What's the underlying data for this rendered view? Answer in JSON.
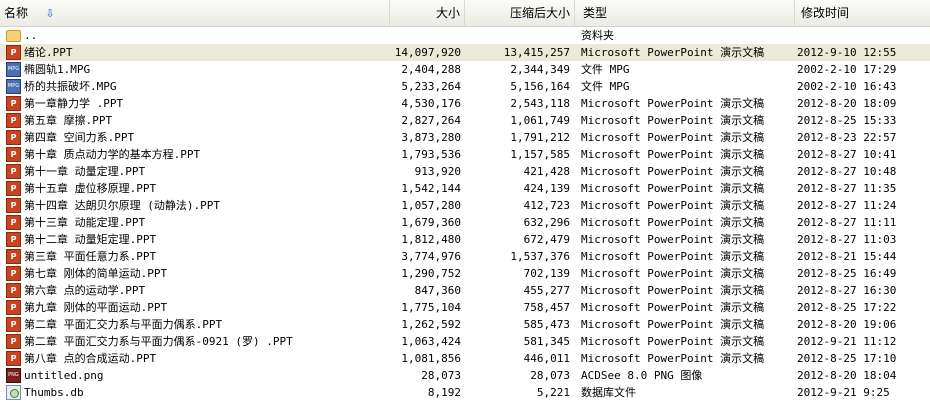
{
  "columns": {
    "name": "名称",
    "size": "大小",
    "compressed": "压缩后大小",
    "type": "类型",
    "modified": "修改时间"
  },
  "files": [
    {
      "name": "..",
      "size": "",
      "compressed": "",
      "type": "资料夹",
      "modified": "",
      "icon": "folder-icon"
    },
    {
      "name": "绪论.PPT",
      "size": "14,097,920",
      "compressed": "13,415,257",
      "type": "Microsoft PowerPoint 演示文稿",
      "modified": "2012-9-10 12:55",
      "icon": "ppt-icon"
    },
    {
      "name": "椭圆轨1.MPG",
      "size": "2,404,288",
      "compressed": "2,344,349",
      "type": "文件 MPG",
      "modified": "2002-2-10 17:29",
      "icon": "mpg-icon"
    },
    {
      "name": "桥的共振破坏.MPG",
      "size": "5,233,264",
      "compressed": "5,156,164",
      "type": "文件 MPG",
      "modified": "2002-2-10 16:43",
      "icon": "mpg-icon"
    },
    {
      "name": "第一章静力学 .PPT",
      "size": "4,530,176",
      "compressed": "2,543,118",
      "type": "Microsoft PowerPoint 演示文稿",
      "modified": "2012-8-20 18:09",
      "icon": "ppt-icon"
    },
    {
      "name": "第五章 摩擦.PPT",
      "size": "2,827,264",
      "compressed": "1,061,749",
      "type": "Microsoft PowerPoint 演示文稿",
      "modified": "2012-8-25 15:33",
      "icon": "ppt-icon"
    },
    {
      "name": "第四章 空间力系.PPT",
      "size": "3,873,280",
      "compressed": "1,791,212",
      "type": "Microsoft PowerPoint 演示文稿",
      "modified": "2012-8-23 22:57",
      "icon": "ppt-icon"
    },
    {
      "name": "第十章 质点动力学的基本方程.PPT",
      "size": "1,793,536",
      "compressed": "1,157,585",
      "type": "Microsoft PowerPoint 演示文稿",
      "modified": "2012-8-27 10:41",
      "icon": "ppt-icon"
    },
    {
      "name": "第十一章 动量定理.PPT",
      "size": "913,920",
      "compressed": "421,428",
      "type": "Microsoft PowerPoint 演示文稿",
      "modified": "2012-8-27 10:48",
      "icon": "ppt-icon"
    },
    {
      "name": "第十五章 虚位移原理.PPT",
      "size": "1,542,144",
      "compressed": "424,139",
      "type": "Microsoft PowerPoint 演示文稿",
      "modified": "2012-8-27 11:35",
      "icon": "ppt-icon"
    },
    {
      "name": "第十四章 达朗贝尔原理 (动静法).PPT",
      "size": "1,057,280",
      "compressed": "412,723",
      "type": "Microsoft PowerPoint 演示文稿",
      "modified": "2012-8-27 11:24",
      "icon": "ppt-icon"
    },
    {
      "name": "第十三章 动能定理.PPT",
      "size": "1,679,360",
      "compressed": "632,296",
      "type": "Microsoft PowerPoint 演示文稿",
      "modified": "2012-8-27 11:11",
      "icon": "ppt-icon"
    },
    {
      "name": "第十二章 动量矩定理.PPT",
      "size": "1,812,480",
      "compressed": "672,479",
      "type": "Microsoft PowerPoint 演示文稿",
      "modified": "2012-8-27 11:03",
      "icon": "ppt-icon"
    },
    {
      "name": "第三章 平面任意力系.PPT",
      "size": "3,774,976",
      "compressed": "1,537,376",
      "type": "Microsoft PowerPoint 演示文稿",
      "modified": "2012-8-21 15:44",
      "icon": "ppt-icon"
    },
    {
      "name": "第七章 刚体的简单运动.PPT",
      "size": "1,290,752",
      "compressed": "702,139",
      "type": "Microsoft PowerPoint 演示文稿",
      "modified": "2012-8-25 16:49",
      "icon": "ppt-icon"
    },
    {
      "name": "第六章 点的运动学.PPT",
      "size": "847,360",
      "compressed": "455,277",
      "type": "Microsoft PowerPoint 演示文稿",
      "modified": "2012-8-27 16:30",
      "icon": "ppt-icon"
    },
    {
      "name": "第九章 刚体的平面运动.PPT",
      "size": "1,775,104",
      "compressed": "758,457",
      "type": "Microsoft PowerPoint 演示文稿",
      "modified": "2012-8-25 17:22",
      "icon": "ppt-icon"
    },
    {
      "name": "第二章 平面汇交力系与平面力偶系.PPT",
      "size": "1,262,592",
      "compressed": "585,473",
      "type": "Microsoft PowerPoint 演示文稿",
      "modified": "2012-8-20 19:06",
      "icon": "ppt-icon"
    },
    {
      "name": "第二章 平面汇交力系与平面力偶系-0921 (罗) .PPT",
      "size": "1,063,424",
      "compressed": "581,345",
      "type": "Microsoft PowerPoint 演示文稿",
      "modified": "2012-9-21 11:12",
      "icon": "ppt-icon"
    },
    {
      "name": "第八章 点的合成运动.PPT",
      "size": "1,081,856",
      "compressed": "446,011",
      "type": "Microsoft PowerPoint 演示文稿",
      "modified": "2012-8-25 17:10",
      "icon": "ppt-icon"
    },
    {
      "name": "untitled.png",
      "size": "28,073",
      "compressed": "28,073",
      "type": "ACDSee 8.0 PNG 图像",
      "modified": "2012-8-20 18:04",
      "icon": "png-icon"
    },
    {
      "name": "Thumbs.db",
      "size": "8,192",
      "compressed": "5,221",
      "type": "数据库文件",
      "modified": "2012-9-21 9:25",
      "icon": "db-icon"
    }
  ],
  "icon_labels": {
    "ppt-icon": "P",
    "mpg-icon": "MPG",
    "png-icon": "PNG",
    "folder-icon": "",
    "db-icon": ""
  },
  "colors": {
    "selected_row": "#ece9d8",
    "sort_arrow": "#2b5fb4"
  }
}
